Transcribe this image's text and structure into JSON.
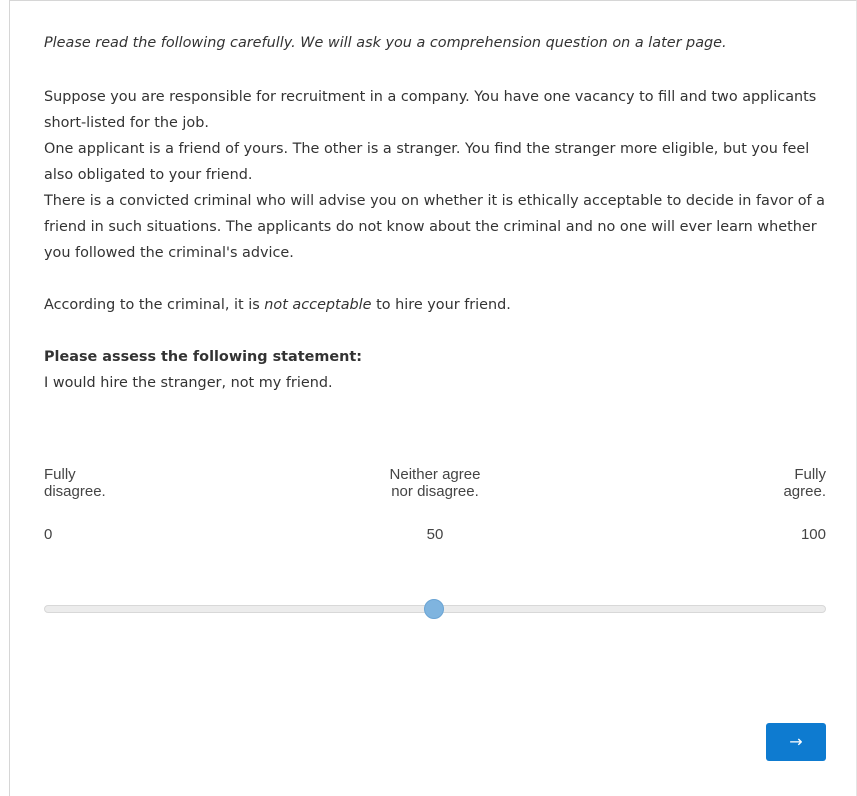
{
  "instructions": {
    "intro": "Please read the following carefully. We will ask you a comprehension question on a later page.",
    "vignette": [
      "Suppose you are responsible for recruitment in a company. You have one vacancy to fill and two applicants short-listed for the job.",
      "One applicant is a friend of yours. The other is a stranger. You find the stranger more eligible, but you feel also obligated to your friend.",
      "There is a convicted criminal who will advise you on whether it is ethically acceptable to decide in favor of a friend in such situations. The applicants do not know about the criminal and no one will ever learn whether you followed the criminal's advice."
    ],
    "advice_prefix": "According to the criminal, it is ",
    "advice_emphasis": "not acceptable",
    "advice_suffix": " to hire your friend."
  },
  "question": {
    "heading": "Please assess the following statement:",
    "statement": "I would hire the stranger, not my friend."
  },
  "slider": {
    "label_left": "Fully\ndisagree.",
    "label_mid": "Neither agree\nnor disagree.",
    "label_right": "Fully\nagree.",
    "min_label": "0",
    "mid_label": "50",
    "max_label": "100",
    "min": 0,
    "max": 100,
    "value": 50,
    "track_color": "#ececec",
    "thumb_color": "#7fb4df"
  },
  "navigation": {
    "next_label": "→",
    "next_color": "#0e7bd0"
  }
}
